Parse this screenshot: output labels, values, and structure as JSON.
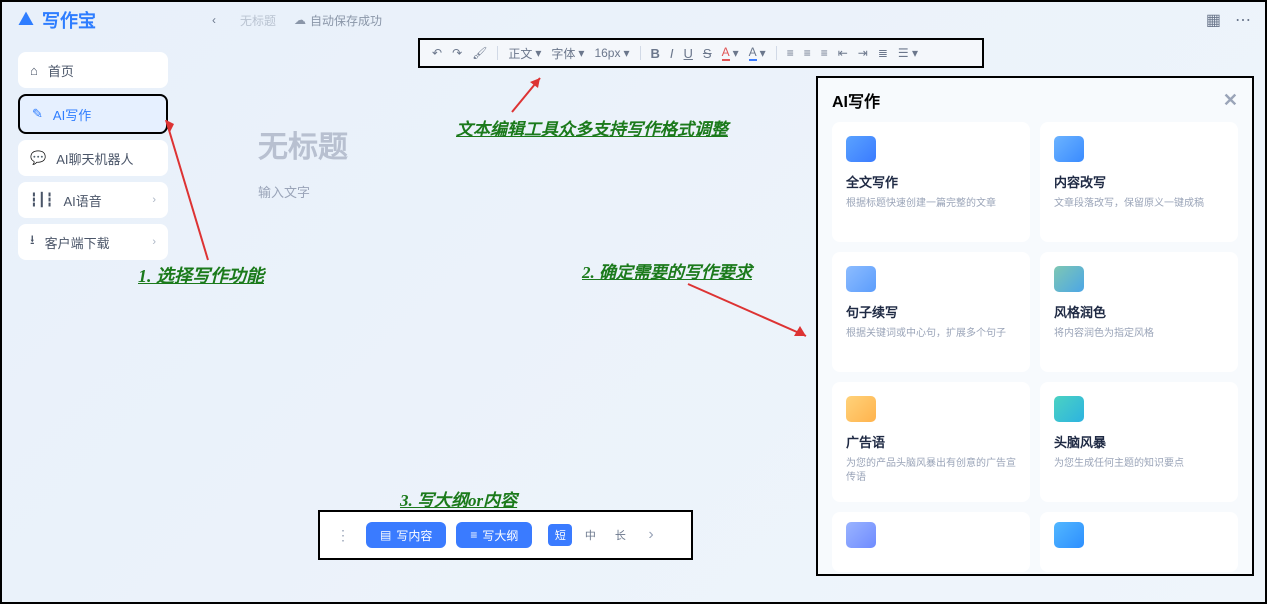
{
  "app": {
    "name": "写作宝"
  },
  "top": {
    "untitled": "无标题",
    "autosave": "自动保存成功"
  },
  "toolbar": {
    "style": "正文",
    "font": "字体",
    "size": "16px",
    "bold": "B",
    "italic": "I",
    "underline": "U",
    "strike": "S",
    "textcolor": "A",
    "bgcolor": "A"
  },
  "sidebar": {
    "items": [
      {
        "label": "首页",
        "icon": "home"
      },
      {
        "label": "AI写作",
        "icon": "pen",
        "active": true
      },
      {
        "label": "AI聊天机器人",
        "icon": "chat"
      },
      {
        "label": "AI语音",
        "icon": "voice",
        "chev": true
      },
      {
        "label": "客户端下载",
        "icon": "download",
        "chev": true
      }
    ]
  },
  "doc": {
    "title_placeholder": "无标题",
    "body_placeholder": "输入文字"
  },
  "bottom": {
    "write_content": "写内容",
    "write_outline": "写大纲",
    "chips": [
      "短",
      "中",
      "长"
    ],
    "active": 0
  },
  "panel": {
    "title": "AI写作",
    "cards": [
      {
        "t": "全文写作",
        "d": "根据标题快速创建一篇完整的文章"
      },
      {
        "t": "内容改写",
        "d": "文章段落改写，保留原义一键成稿"
      },
      {
        "t": "句子续写",
        "d": "根据关键词或中心句，扩展多个句子"
      },
      {
        "t": "风格润色",
        "d": "将内容润色为指定风格"
      },
      {
        "t": "广告语",
        "d": "为您的产品头脑风暴出有创意的广告宣传语"
      },
      {
        "t": "头脑风暴",
        "d": "为您生成任何主题的知识要点"
      }
    ]
  },
  "annotations": {
    "a1": "1. 选择写作功能",
    "a2": "文本编辑工具众多支持写作格式调整",
    "a3": "2. 确定需要的写作要求",
    "a4": "3. 写大纲or内容"
  }
}
